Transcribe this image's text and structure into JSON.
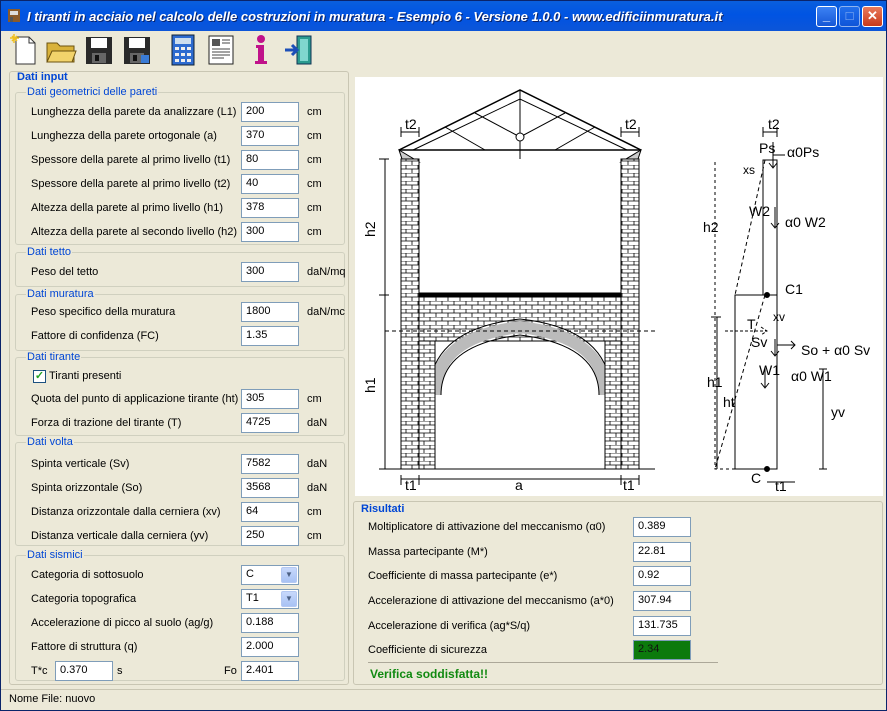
{
  "window": {
    "title": "I tiranti in acciaio nel calcolo delle costruzioni in muratura  -  Esempio 6  -  Versione 1.0.0  -  www.edificiinmuratura.it",
    "minimize": "_",
    "maximize": "□",
    "close": "✕",
    "title_color": "#0054e3"
  },
  "toolbar": [
    "new-file-icon",
    "open-folder-icon",
    "save-icon",
    "save-as-icon",
    "calculator-icon",
    "report-icon",
    "info-icon",
    "exit-icon"
  ],
  "input": {
    "heading": "Dati input",
    "geo": {
      "heading": "Dati geometrici delle pareti",
      "rows": [
        {
          "label": "Lunghezza della parete da analizzare (L1)",
          "value": "200",
          "unit": "cm"
        },
        {
          "label": "Lunghezza della parete ortogonale (a)",
          "value": "370",
          "unit": "cm"
        },
        {
          "label": "Spessore della parete al primo livello (t1)",
          "value": "80",
          "unit": "cm"
        },
        {
          "label": "Spessore della parete al primo livello (t2)",
          "value": "40",
          "unit": "cm"
        },
        {
          "label": "Altezza della parete al primo livello  (h1)",
          "value": "378",
          "unit": "cm"
        },
        {
          "label": "Altezza della parete al secondo livello  (h2)",
          "value": "300",
          "unit": "cm"
        }
      ]
    },
    "tetto": {
      "heading": "Dati tetto",
      "rows": [
        {
          "label": "Peso del tetto",
          "value": "300",
          "unit": "daN/mq"
        }
      ]
    },
    "muratura": {
      "heading": "Dati muratura",
      "rows": [
        {
          "label": "Peso specifico della muratura",
          "value": "1800",
          "unit": "daN/mc"
        },
        {
          "label": "Fattore di confidenza (FC)",
          "value": "1.35",
          "unit": ""
        }
      ]
    },
    "tirante": {
      "heading": "Dati tirante",
      "check_label": "Tiranti presenti",
      "check": "✓",
      "rows": [
        {
          "label": "Quota del punto di applicazione tirante (ht)",
          "value": "305",
          "unit": "cm"
        },
        {
          "label": "Forza di trazione del tirante (T)",
          "value": "4725",
          "unit": "daN"
        }
      ]
    },
    "volta": {
      "heading": "Dati volta",
      "rows": [
        {
          "label": "Spinta verticale (Sv)",
          "value": "7582",
          "unit": "daN"
        },
        {
          "label": "Spinta orizzontale (So)",
          "value": "3568",
          "unit": "daN"
        },
        {
          "label": "Distanza orizzontale dalla cerniera (xv)",
          "value": "64",
          "unit": "cm"
        },
        {
          "label": "Distanza verticale dalla cerniera (yv)",
          "value": "250",
          "unit": "cm"
        }
      ]
    },
    "sismici": {
      "heading": "Dati sismici",
      "categoria_sottosuolo": {
        "label": "Categoria di sottosuolo",
        "value": "C"
      },
      "categoria_topografica": {
        "label": "Categoria topografica",
        "value": "T1"
      },
      "ag": {
        "label": "Accelerazione di picco al suolo (ag/g)",
        "value": "0.188"
      },
      "q": {
        "label": "Fattore di struttura (q)",
        "value": "2.000"
      },
      "tc": {
        "label": "T*c",
        "value": "0.370",
        "unit": "s"
      },
      "fo": {
        "label": "Fo",
        "value": "2.401"
      }
    }
  },
  "drawing": {
    "t2": "t2",
    "h2": "h2",
    "h1": "h1",
    "t1": "t1",
    "a": "a",
    "C": "C",
    "C1": "C1",
    "T": "T",
    "ht": "ht",
    "xs": "xs",
    "xv": "xv",
    "yv": "yv",
    "Sv": "Sv",
    "Ps": "Ps",
    "aPs": "α0Ps",
    "W2": "W2",
    "aW2": "α0 W2",
    "W1": "W1",
    "aW1": "α0 W1",
    "So": "So + α0 Sv"
  },
  "results": {
    "heading": "Risultati",
    "rows": [
      {
        "label": "Moltiplicatore di attivazione del meccanismo (α0)",
        "value": "0.389"
      },
      {
        "label": "Massa partecipante (M*)",
        "value": "22.81"
      },
      {
        "label": "Coefficiente di massa partecipante (e*)",
        "value": "0.92"
      },
      {
        "label": "Accelerazione di attivazione del meccanismo (a*0)",
        "value": "307.94"
      },
      {
        "label": "Accelerazione di verifica (ag*S/q)",
        "value": "131.735"
      },
      {
        "label": "Coefficiente di sicurezza",
        "value": "2.34",
        "color": "#0c7a0c"
      }
    ],
    "verdict": "Verifica soddisfatta!!"
  },
  "status": "Nome File: nuovo"
}
